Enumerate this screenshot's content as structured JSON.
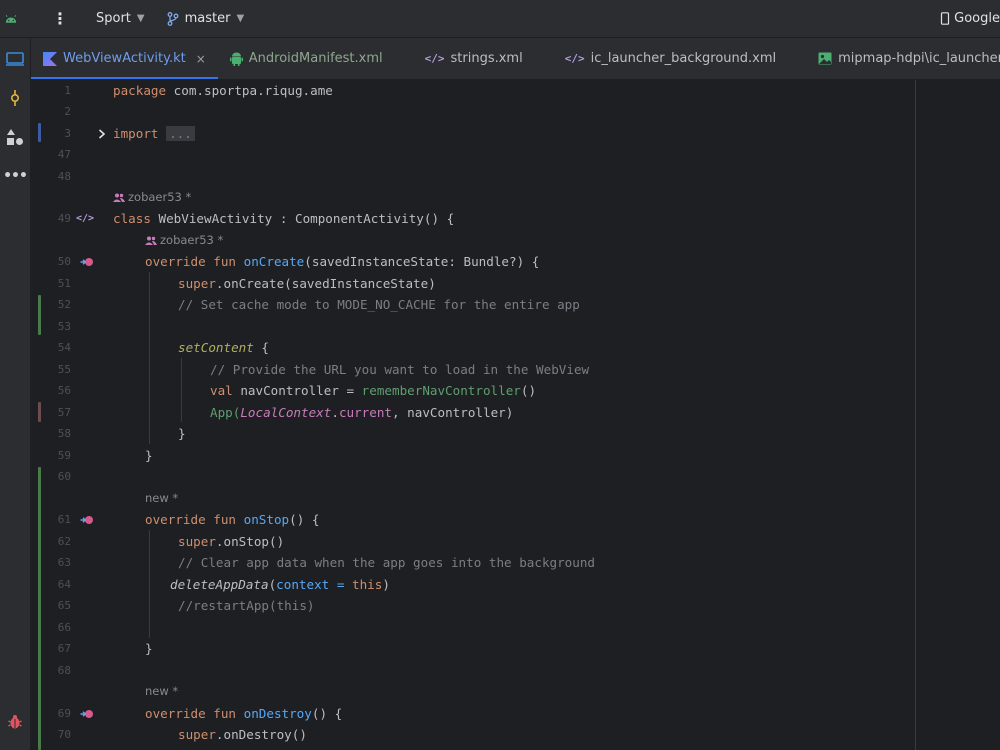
{
  "topbar": {
    "project": "Sport",
    "branch": "master",
    "device": "Google"
  },
  "tabs": [
    {
      "label": "WebViewActivity.kt",
      "icon": "kotlin-icon",
      "active": true,
      "close": "×"
    },
    {
      "label": "AndroidManifest.xml",
      "icon": "android-icon",
      "active": false
    },
    {
      "label": "strings.xml",
      "icon": "xml-icon",
      "active": false
    },
    {
      "label": "ic_launcher_background.xml",
      "icon": "xml-icon",
      "active": false
    },
    {
      "label": "mipmap-hdpi\\ic_launcher.webp",
      "icon": "image-icon",
      "active": false
    }
  ],
  "editor": {
    "fold_placeholder": "...",
    "inlay_author_class": "zobaer53 *",
    "inlay_author_fun": "zobaer53 *",
    "inlay_new_1": "new *",
    "inlay_new_2": "new *",
    "line_numbers": [
      "1",
      "2",
      "3",
      "47",
      "48",
      "49",
      "50",
      "51",
      "52",
      "53",
      "54",
      "55",
      "56",
      "57",
      "58",
      "59",
      "60",
      "61",
      "62",
      "63",
      "64",
      "65",
      "66",
      "67",
      "68",
      "69",
      "70"
    ],
    "code": {
      "l1_kw": "package",
      "l1_rest": " com.sportpa.riqug.ame",
      "l3_kw": "import",
      "l49_kw": "class",
      "l49_rest": " WebViewActivity : ComponentActivity() {",
      "l50_kw1": "override",
      "l50_kw2": "fun",
      "l50_fn": "onCreate",
      "l50_rest": "(savedInstanceState: Bundle?) {",
      "l51_kw": "super",
      "l51_rest": ".onCreate(savedInstanceState)",
      "l52_cm": "// Set cache mode to MODE_NO_CACHE for the entire app",
      "l54_fn": "setContent",
      "l54_rest": " {",
      "l55_cm": "// Provide the URL you want to load in the WebView",
      "l56_kw": "val",
      "l56_var": " navController = ",
      "l56_call": "rememberNavController",
      "l56_rest": "()",
      "l57_fn": "App",
      "l57_open": "(",
      "l57_ctx": "LocalContext",
      "l57_dot": ".",
      "l57_prop": "current",
      "l57_rest": ", navController)",
      "l58": "}",
      "l59": "}",
      "l61_kw1": "override",
      "l61_kw2": "fun",
      "l61_fn": "onStop",
      "l61_rest": "() {",
      "l62_kw": "super",
      "l62_rest": ".onStop()",
      "l63_cm": "// Clear app data when the app goes into the background",
      "l64_fn": "deleteAppData",
      "l64_open": "(",
      "l64_param": "context",
      "l64_eq": " = ",
      "l64_this": "this",
      "l64_close": ")",
      "l65_cm": "//restartApp(this)",
      "l67": "}",
      "l69_kw1": "override",
      "l69_kw2": "fun",
      "l69_fn": "onDestroy",
      "l69_rest": "() {",
      "l70_kw": "super",
      "l70_rest": ".onDestroy()"
    }
  },
  "colors": {
    "background": "#1e1f22",
    "panel": "#2b2d30",
    "keyword": "#cf8e6d",
    "function": "#56a8f5",
    "comment": "#7a7e85",
    "accent": "#3574f0"
  }
}
